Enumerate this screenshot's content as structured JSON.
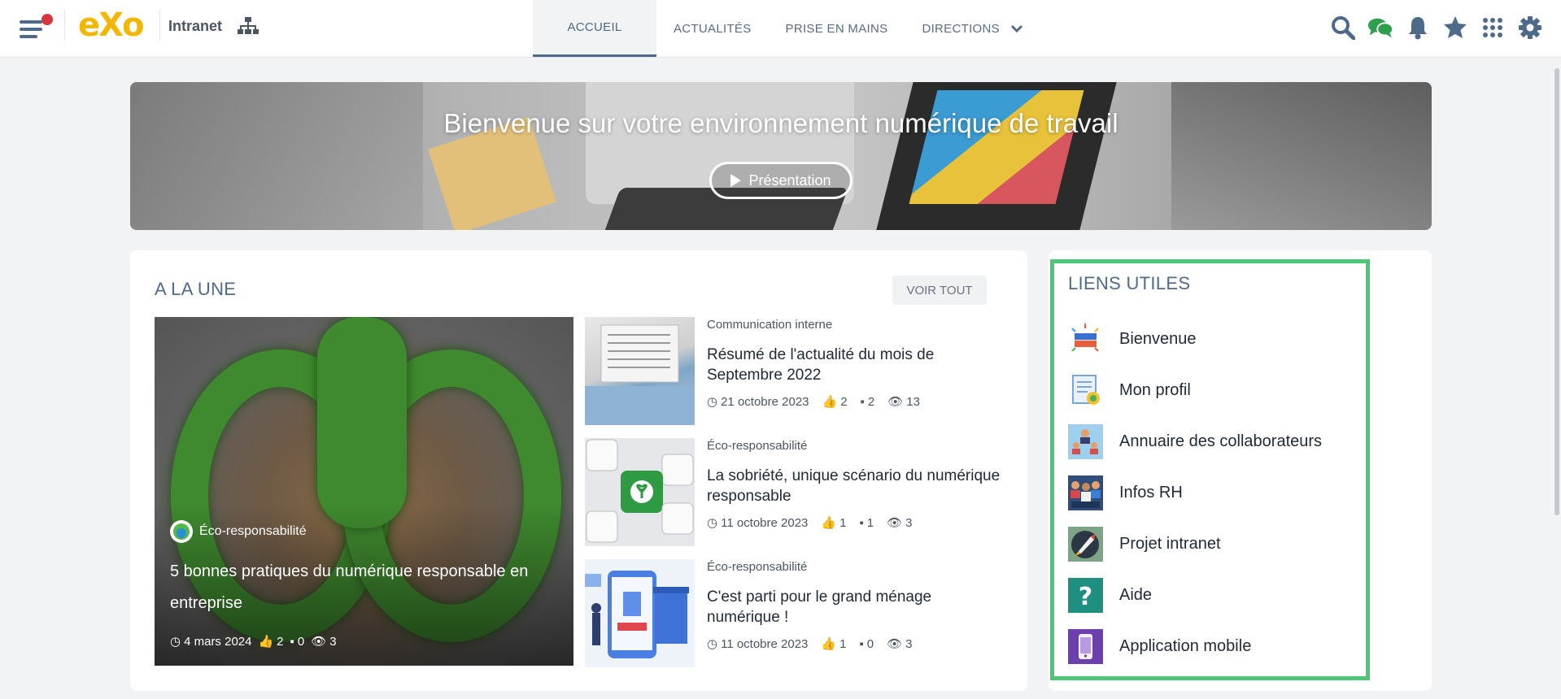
{
  "topbar": {
    "brand": "eXo",
    "site_name": "Intranet",
    "nav": [
      {
        "label": "ACCUEIL"
      },
      {
        "label": "ACTUALITÉS"
      },
      {
        "label": "PRISE EN MAINS"
      },
      {
        "label": "DIRECTIONS"
      }
    ],
    "icons": [
      "search-icon",
      "chat-icon",
      "bell-icon",
      "star-icon",
      "apps-grid-icon",
      "gear-icon"
    ]
  },
  "hero": {
    "title": "Bienvenue sur votre environnement numérique de travail",
    "button_label": "Présentation"
  },
  "news": {
    "section_title": "A LA UNE",
    "voir_tout": "VOIR TOUT",
    "featured": {
      "category": "Éco-responsabilité",
      "title": "5 bonnes pratiques du numérique responsable en entreprise",
      "date": "4 mars 2024",
      "likes": "2",
      "comments": "0",
      "views": "3"
    },
    "items": [
      {
        "category": "Communication interne",
        "title": "Résumé de l'actualité du mois de Septembre 2022",
        "date": "21 octobre 2023",
        "likes": "2",
        "comments": "2",
        "views": "13"
      },
      {
        "category": "Éco-responsabilité",
        "title": "La sobriété, unique scénario du numérique responsable",
        "date": "11 octobre 2023",
        "likes": "1",
        "comments": "1",
        "views": "3"
      },
      {
        "category": "Éco-responsabilité",
        "title": "C'est parti pour le grand ménage numérique !",
        "date": "11 octobre 2023",
        "likes": "1",
        "comments": "0",
        "views": "3"
      }
    ]
  },
  "links": {
    "section_title": "LIENS UTILES",
    "items": [
      {
        "label": "Bienvenue",
        "icon": "bienvenue-icon"
      },
      {
        "label": "Mon profil",
        "icon": "profile-document-icon"
      },
      {
        "label": "Annuaire des collaborateurs",
        "icon": "directory-icon"
      },
      {
        "label": "Infos RH",
        "icon": "hr-people-icon"
      },
      {
        "label": "Projet intranet",
        "icon": "rocket-icon"
      },
      {
        "label": "Aide",
        "icon": "help-icon"
      },
      {
        "label": "Application mobile",
        "icon": "mobile-phone-icon"
      }
    ],
    "highlight_color": "#4cc777"
  },
  "colors": {
    "accent": "#4e6a8a",
    "notification": "#d6363f",
    "chat": "#2e9e4f",
    "brand": "#f2b705"
  }
}
